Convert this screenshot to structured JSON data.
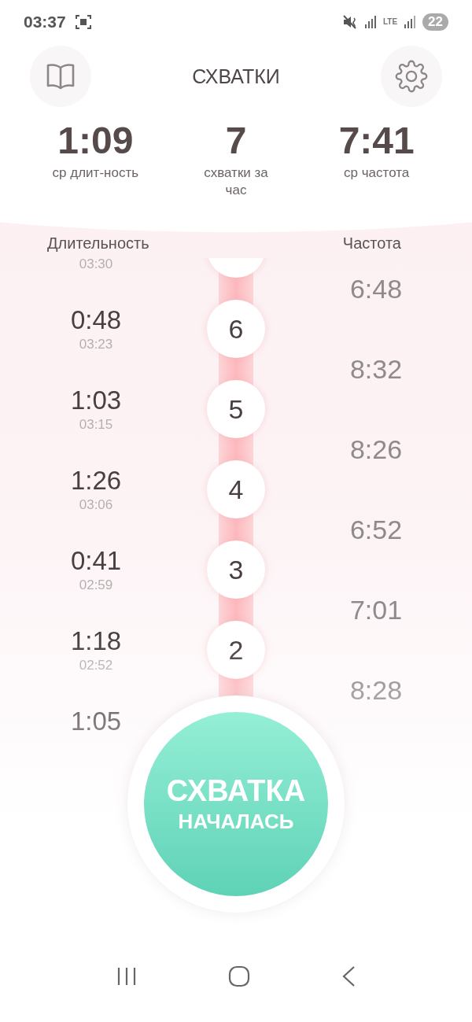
{
  "status_bar": {
    "time": "03:37",
    "network": "LTE",
    "battery": "22"
  },
  "header": {
    "title": "СХВАТКИ"
  },
  "stats": [
    {
      "value": "1:09",
      "label": "ср длит-ность"
    },
    {
      "value": "7",
      "label": "схватки за час"
    },
    {
      "value": "7:41",
      "label": "ср частота"
    }
  ],
  "columns": {
    "duration": "Длительность",
    "frequency": "Частота"
  },
  "contractions": [
    {
      "time": "03:30"
    },
    {
      "number": "6",
      "duration": "0:48",
      "time": "03:23"
    },
    {
      "number": "5",
      "duration": "1:03",
      "time": "03:15"
    },
    {
      "number": "4",
      "duration": "1:26",
      "time": "03:06"
    },
    {
      "number": "3",
      "duration": "0:41",
      "time": "02:59"
    },
    {
      "number": "2",
      "duration": "1:18",
      "time": "02:52"
    },
    {
      "duration": "1:05"
    }
  ],
  "frequencies": [
    "6:48",
    "8:32",
    "8:26",
    "6:52",
    "7:01",
    "8:28"
  ],
  "start_button": {
    "line_1": "СХВАТКА",
    "line_2": "НАЧАЛАСЬ"
  }
}
